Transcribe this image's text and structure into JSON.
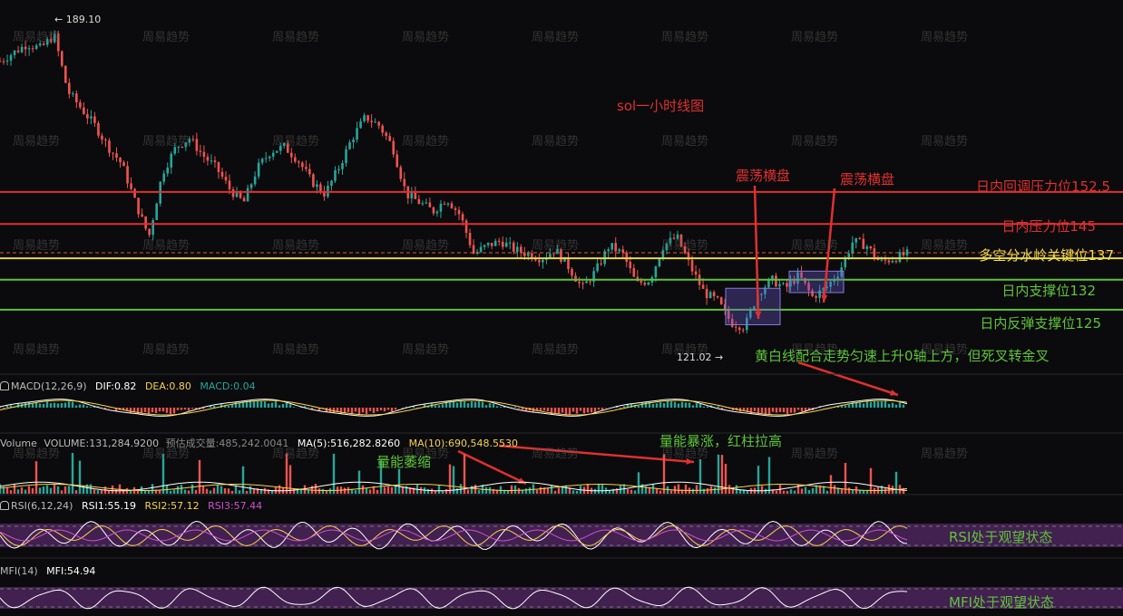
{
  "chart_data": [
    {
      "type": "candlestick",
      "title": "sol一小时线图",
      "price_range": [
        115,
        192
      ],
      "annotations": {
        "high": "← 189.10",
        "low": "121.02 →",
        "consolidation_1": "震荡横盘",
        "consolidation_2": "震荡横盘",
        "macd_note": "黄白线配合走势匀速上升0轴上方，但死叉转金叉"
      },
      "levels": [
        {
          "name": "日内回调压力位152.5",
          "value": 152.5,
          "color": "#e03030"
        },
        {
          "name": "日内压力位145",
          "value": 145,
          "color": "#e03030"
        },
        {
          "name": "多空分水岭关键位137",
          "value": 137,
          "color": "#e8d84a"
        },
        {
          "name": "日内支撑位132",
          "value": 132,
          "color": "#5ec43a"
        },
        {
          "name": "日内反弹支撑位125",
          "value": 125,
          "color": "#5ec43a"
        }
      ],
      "current_price": 138.3,
      "price_path": [
        183,
        185,
        187,
        186,
        189.1,
        176,
        172,
        168,
        163,
        159,
        150,
        142,
        157,
        163,
        165,
        161,
        158,
        153,
        150,
        158,
        162,
        163,
        160,
        155,
        152,
        158,
        165,
        170,
        168,
        163,
        152,
        150,
        148,
        151,
        147,
        138,
        140,
        141,
        139,
        138,
        137,
        139,
        135,
        130,
        134,
        140,
        138,
        131,
        132,
        140,
        142,
        135,
        129,
        127,
        122,
        121,
        129,
        132,
        130,
        133,
        128,
        130,
        134,
        141,
        140,
        136,
        137,
        138
      ],
      "boxes": [
        {
          "from": 0.8,
          "to": 0.86,
          "high": 130,
          "low": 121.5
        },
        {
          "from": 0.87,
          "to": 0.93,
          "high": 134,
          "low": 129
        }
      ]
    },
    {
      "type": "line",
      "indicator": "MACD(12,26,9)",
      "values": {
        "DIF": "DIF:0.82",
        "DEA": "DEA:0.80",
        "MACD": "MACD:0.04"
      }
    },
    {
      "type": "bar",
      "indicator": "Volume",
      "values": {
        "volume": "VOLUME:131,284.9200",
        "pred": "预估成交量:485,242.0041",
        "ma5": "MA(5):516,282.8260",
        "ma10": "MA(10):690,548.5530"
      },
      "notes": {
        "shrink": "量能萎缩",
        "surge": "量能暴涨，红柱拉高"
      }
    },
    {
      "type": "line",
      "indicator": "RSI(6,12,24)",
      "values": {
        "rsi1": "RSI1:55.19",
        "rsi2": "RSI2:57.12",
        "rsi3": "RSI3:57.44"
      },
      "note": "RSI处于观望状态"
    },
    {
      "type": "line",
      "indicator": "MFI(14)",
      "values": {
        "mfi": "MFI:54.94"
      },
      "note": "MFI处于观望状态"
    }
  ],
  "watermark": "周易趋势",
  "colors": {
    "up": "#26a69a",
    "down": "#ef5350",
    "dif": "#ffffff",
    "dea": "#f5d34a",
    "purple": "#5a2a6e"
  }
}
